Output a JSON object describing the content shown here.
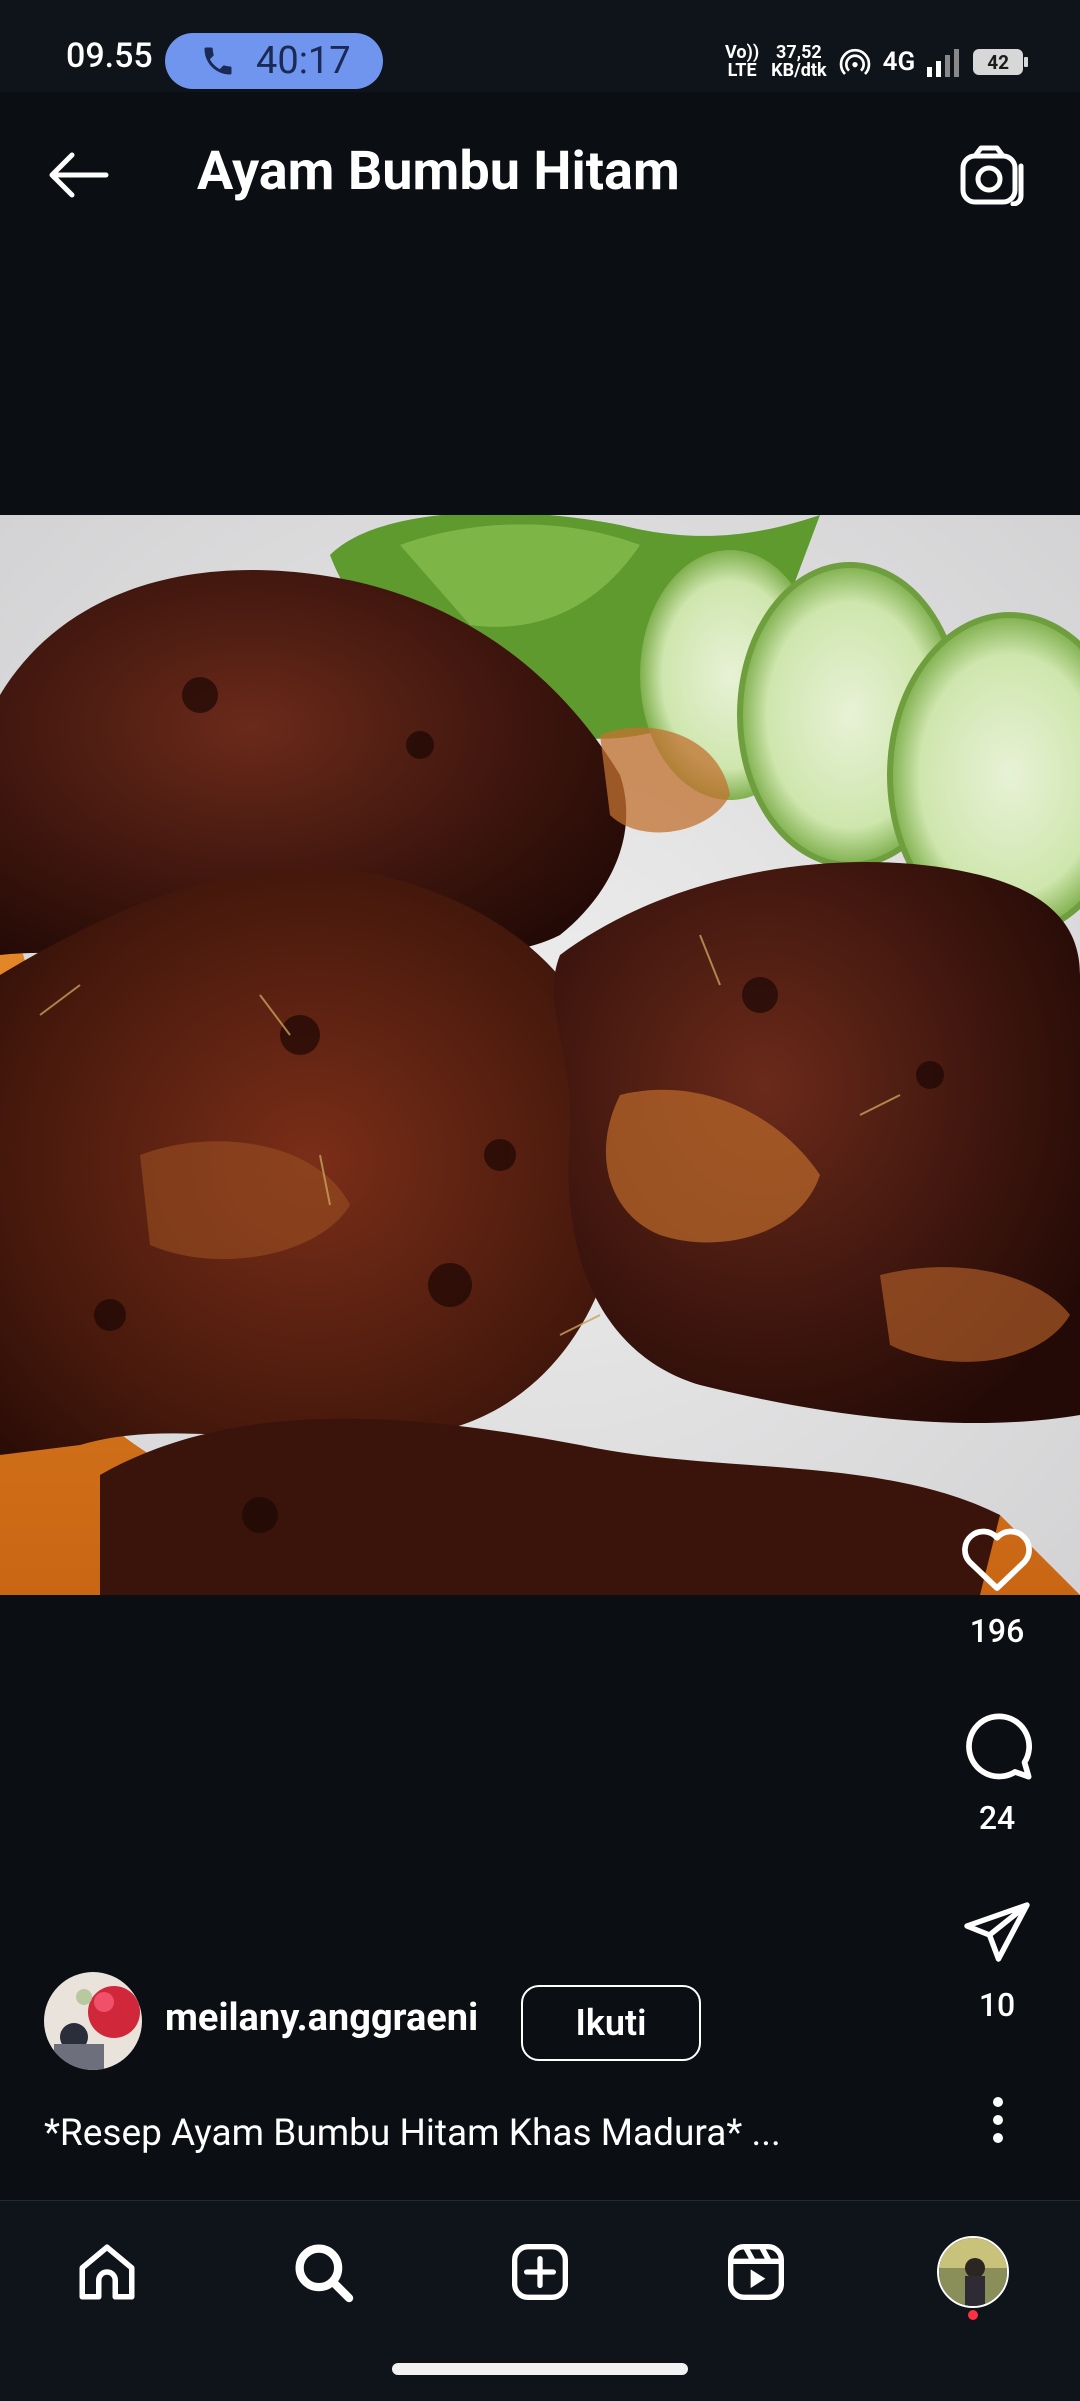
{
  "status_bar": {
    "time": "09.55",
    "call_timer": "40:17",
    "volte_top": "Vo))",
    "volte_bottom": "LTE",
    "speed_value": "37,52",
    "speed_unit": "KB/dtk",
    "network": "4G",
    "battery": "42"
  },
  "header": {
    "title": "Ayam Bumbu Hitam"
  },
  "actions": {
    "likes": "196",
    "comments": "24",
    "shares": "10"
  },
  "author": {
    "username": "meilany.anggraeni",
    "follow_label": "Ikuti"
  },
  "caption": "*Resep Ayam Bumbu Hitam Khas Madura* ...",
  "colors": {
    "background": "#0b0e13",
    "call_pill": "#6f95ef",
    "notification_dot": "#ff3040"
  },
  "icons": {
    "back": "arrow-left-icon",
    "camera": "camera-icon",
    "like": "heart-icon",
    "comment": "comment-icon",
    "share": "send-icon",
    "more": "more-vertical-icon",
    "nav": [
      "home-icon",
      "search-icon",
      "create-icon",
      "reels-icon",
      "profile-avatar"
    ]
  }
}
